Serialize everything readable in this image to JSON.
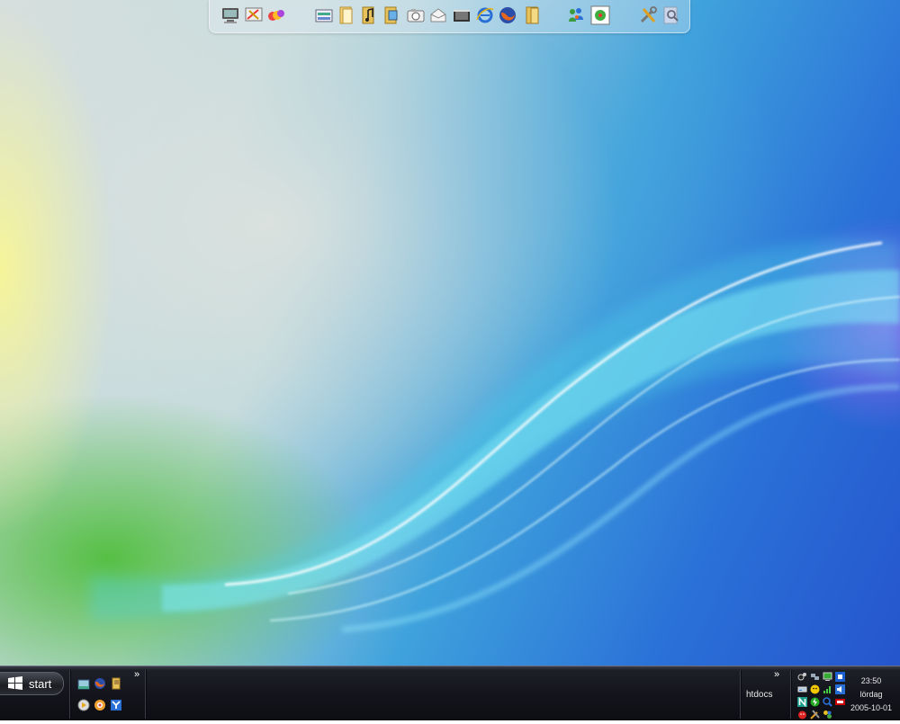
{
  "taskbar": {
    "start_label": "start",
    "quick_launch_more": "»",
    "tray_more": "»",
    "toolbar_label": "htdocs",
    "clock": {
      "time": "23:50",
      "day": "lördag",
      "date": "2005-10-01"
    }
  },
  "dock": {
    "icons": [
      "my-computer-icon",
      "display-settings-icon",
      "paint-icon",
      "control-panel-icon",
      "documents-folder-icon",
      "music-folder-icon",
      "pictures-folder-icon",
      "camera-icon",
      "mail-icon",
      "video-folder-icon",
      "internet-explorer-icon",
      "firefox-icon",
      "folder-icon",
      "messenger-icon",
      "icq-icon",
      "tools-icon",
      "search-icon"
    ]
  },
  "colors": {
    "taskbar_bg": "#14151c",
    "firefox": "#e8661c",
    "ie_blue": "#2a6fd6"
  }
}
